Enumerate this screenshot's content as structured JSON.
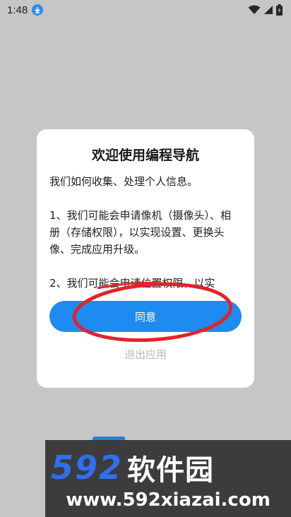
{
  "status_bar": {
    "time": "1:48",
    "icons": [
      "download-icon",
      "wifi-icon",
      "signal-icon",
      "battery-icon"
    ]
  },
  "dialog": {
    "title": "欢迎使用编程导航",
    "paragraphs": [
      "我们如何收集、处理个人信息。",
      "1、我们可能会申请像机（摄像头）、相册（存储权限），以实现设置、更换头像、完成应用升级。",
      "2、我们可能会申请位置权限，以实"
    ],
    "agree_label": "同意",
    "exit_label": "退出应用"
  },
  "annotation": {
    "color": "#e0242b"
  },
  "watermark": {
    "number": "592",
    "chinese": "软件园",
    "url": "www.592xiazai.com"
  },
  "colors": {
    "accent": "#1e8bf0",
    "scrim": "#c6c6c6",
    "exit_text": "#b9b9b9"
  }
}
